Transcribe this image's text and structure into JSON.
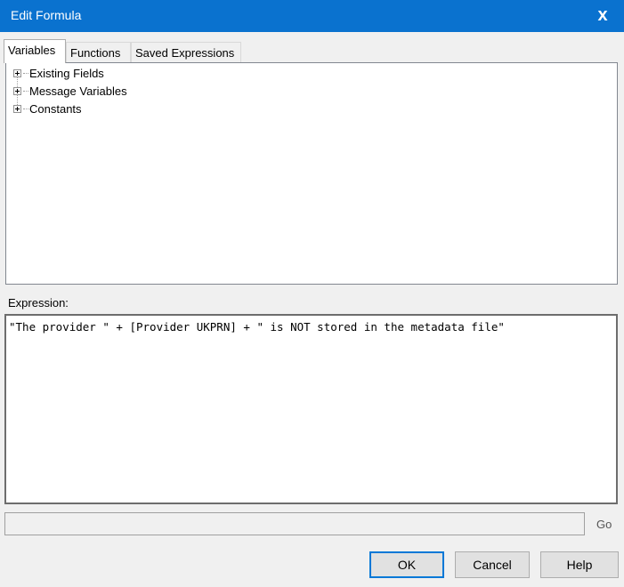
{
  "window": {
    "title": "Edit Formula",
    "close_glyph": "x"
  },
  "tabs": [
    {
      "label": "Variables",
      "active": true
    },
    {
      "label": "Functions",
      "active": false
    },
    {
      "label": "Saved Expressions",
      "active": false
    }
  ],
  "tree": {
    "items": [
      {
        "label": "Existing Fields",
        "expanded": false
      },
      {
        "label": "Message Variables",
        "expanded": false
      },
      {
        "label": "Constants",
        "expanded": false
      }
    ]
  },
  "expression": {
    "label": "Expression:",
    "value": "\"The provider \" + [Provider UKPRN] + \" is NOT stored in the metadata file\""
  },
  "status": {
    "text": "",
    "go_label": "Go"
  },
  "buttons": {
    "ok": "OK",
    "cancel": "Cancel",
    "help": "Help"
  },
  "colors": {
    "titlebar": "#0a72cf",
    "default_button_border": "#0078d7"
  }
}
